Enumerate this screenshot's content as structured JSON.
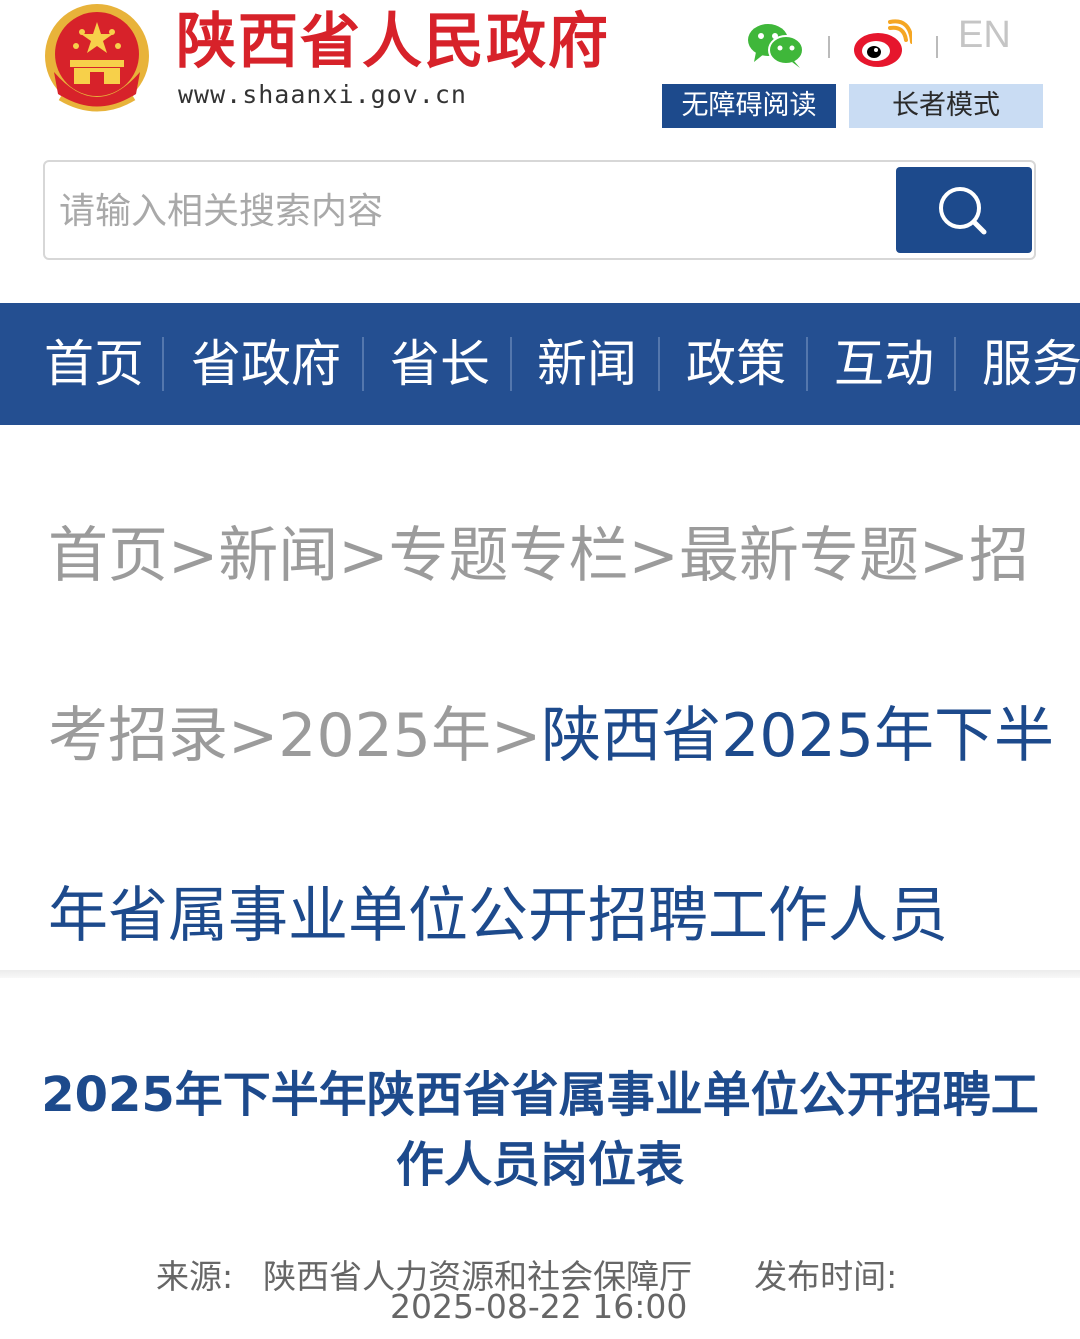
{
  "header": {
    "title": "陕西省人民政府",
    "url": "www.shaanxi.gov.cn",
    "lang_label": "EN",
    "accessible_label": "无障碍阅读",
    "elder_label": "长者模式"
  },
  "search": {
    "placeholder": "请输入相关搜索内容"
  },
  "nav": {
    "items": [
      "首页",
      "省政府",
      "省长",
      "新闻",
      "政策",
      "互动",
      "服务"
    ]
  },
  "breadcrumb": {
    "line1": "首页>新闻>专题专栏>最新专题>招",
    "line2_prefix": "考招录>2025年>",
    "line2_current": "陕西省2025年下半",
    "line3_current": "年省属事业单位公开招聘工作人员"
  },
  "article": {
    "title": "2025年下半年陕西省省属事业单位公开招聘工作人员岗位表",
    "source_label": "来源:",
    "source_value": "陕西省人力资源和社会保障厅",
    "publish_label": "发布时间:",
    "publish_time": "2025-08-22 16:00"
  },
  "colors": {
    "brand_red": "#d7222a",
    "nav_blue": "#244f91",
    "accent_blue": "#1d4a8c",
    "elder_bg": "#c9dcf3"
  },
  "icons": {
    "emblem": "national-emblem-icon",
    "wechat": "wechat-icon",
    "weibo": "weibo-icon",
    "search": "search-icon"
  }
}
